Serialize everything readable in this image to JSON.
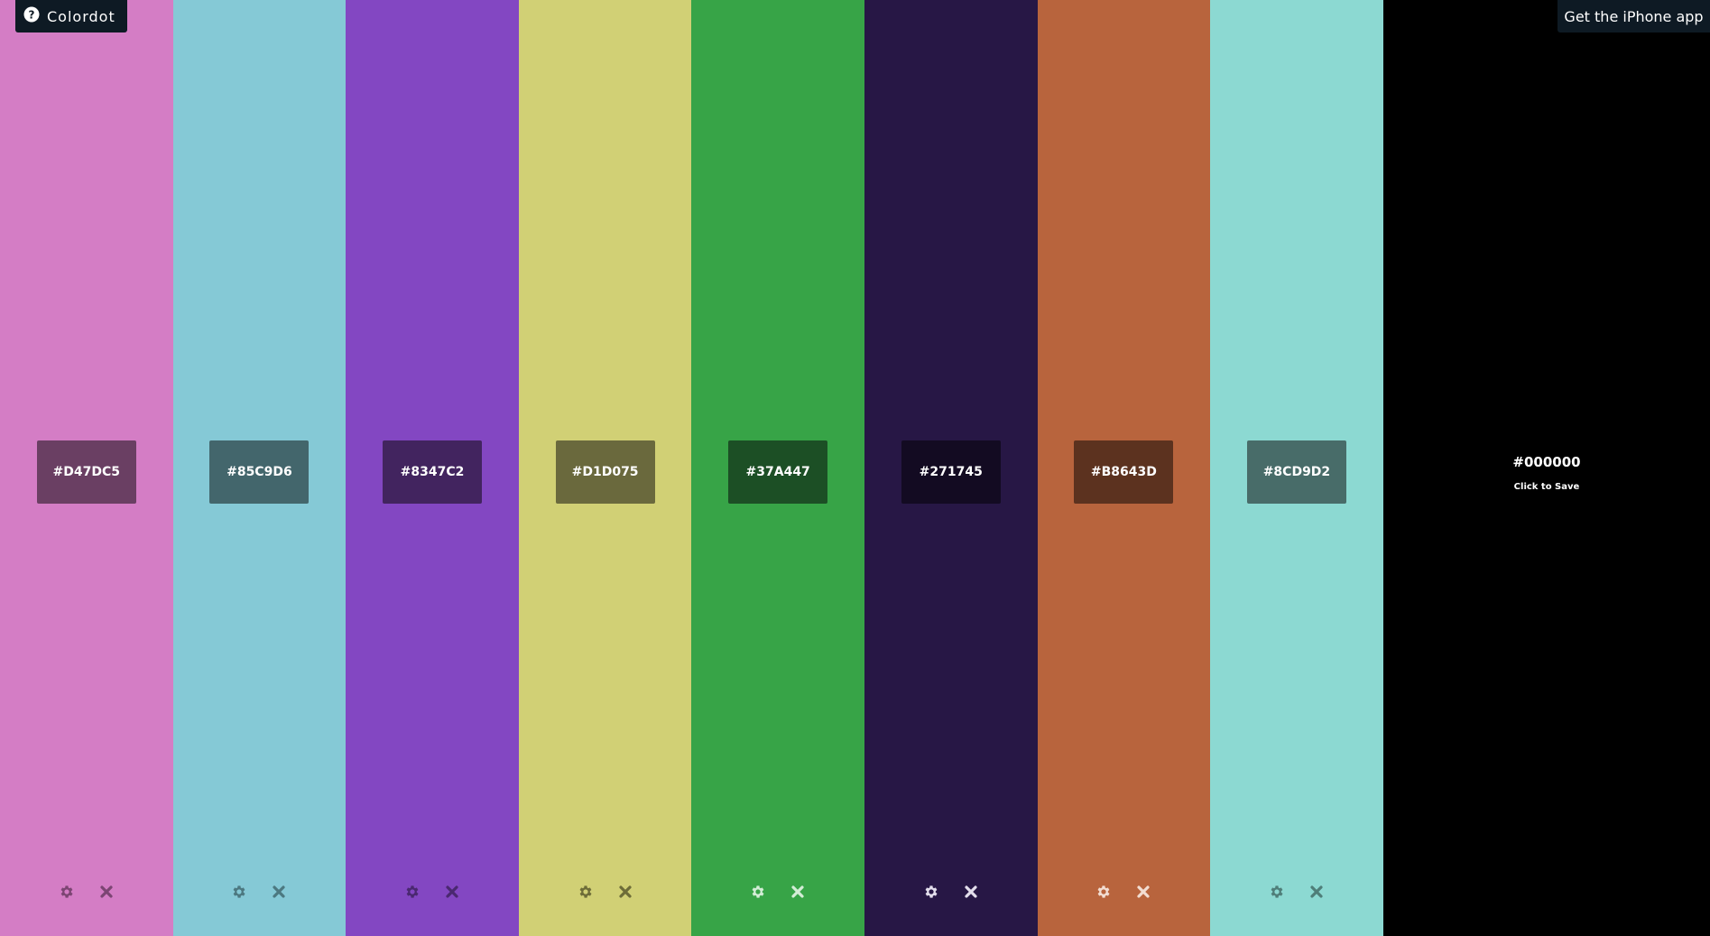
{
  "brand": {
    "name": "Colordot",
    "icon": "question-circle-icon"
  },
  "header": {
    "iphone_link": "Get the iPhone app"
  },
  "swatches": [
    {
      "hex": "#D47DC5",
      "label": "#D47DC5",
      "badge": "#6A3F63",
      "icon_color": "#7C4573"
    },
    {
      "hex": "#85C9D6",
      "label": "#85C9D6",
      "badge": "#43666C",
      "icon_color": "#4C7880"
    },
    {
      "hex": "#8347C2",
      "label": "#8347C2",
      "badge": "#42245F",
      "icon_color": "#4A2870"
    },
    {
      "hex": "#D1D075",
      "label": "#D1D075",
      "badge": "#6A693D",
      "icon_color": "#6D6C38"
    },
    {
      "hex": "#37A447",
      "label": "#37A447",
      "badge": "#1C4F25",
      "icon_color": "#D3EDD6"
    },
    {
      "hex": "#271745",
      "label": "#271745",
      "badge": "#130B22",
      "icon_color": "#E3DEEC"
    },
    {
      "hex": "#B8643D",
      "label": "#B8643D",
      "badge": "#5C321F",
      "icon_color": "#F2DDD2"
    },
    {
      "hex": "#8CD9D2",
      "label": "#8CD9D2",
      "badge": "#486C69",
      "icon_color": "#4F7E79"
    }
  ],
  "save_panel": {
    "hex": "#000000",
    "hint": "Click to Save"
  },
  "icons": {
    "settings": "gear-icon",
    "remove": "close-icon"
  }
}
